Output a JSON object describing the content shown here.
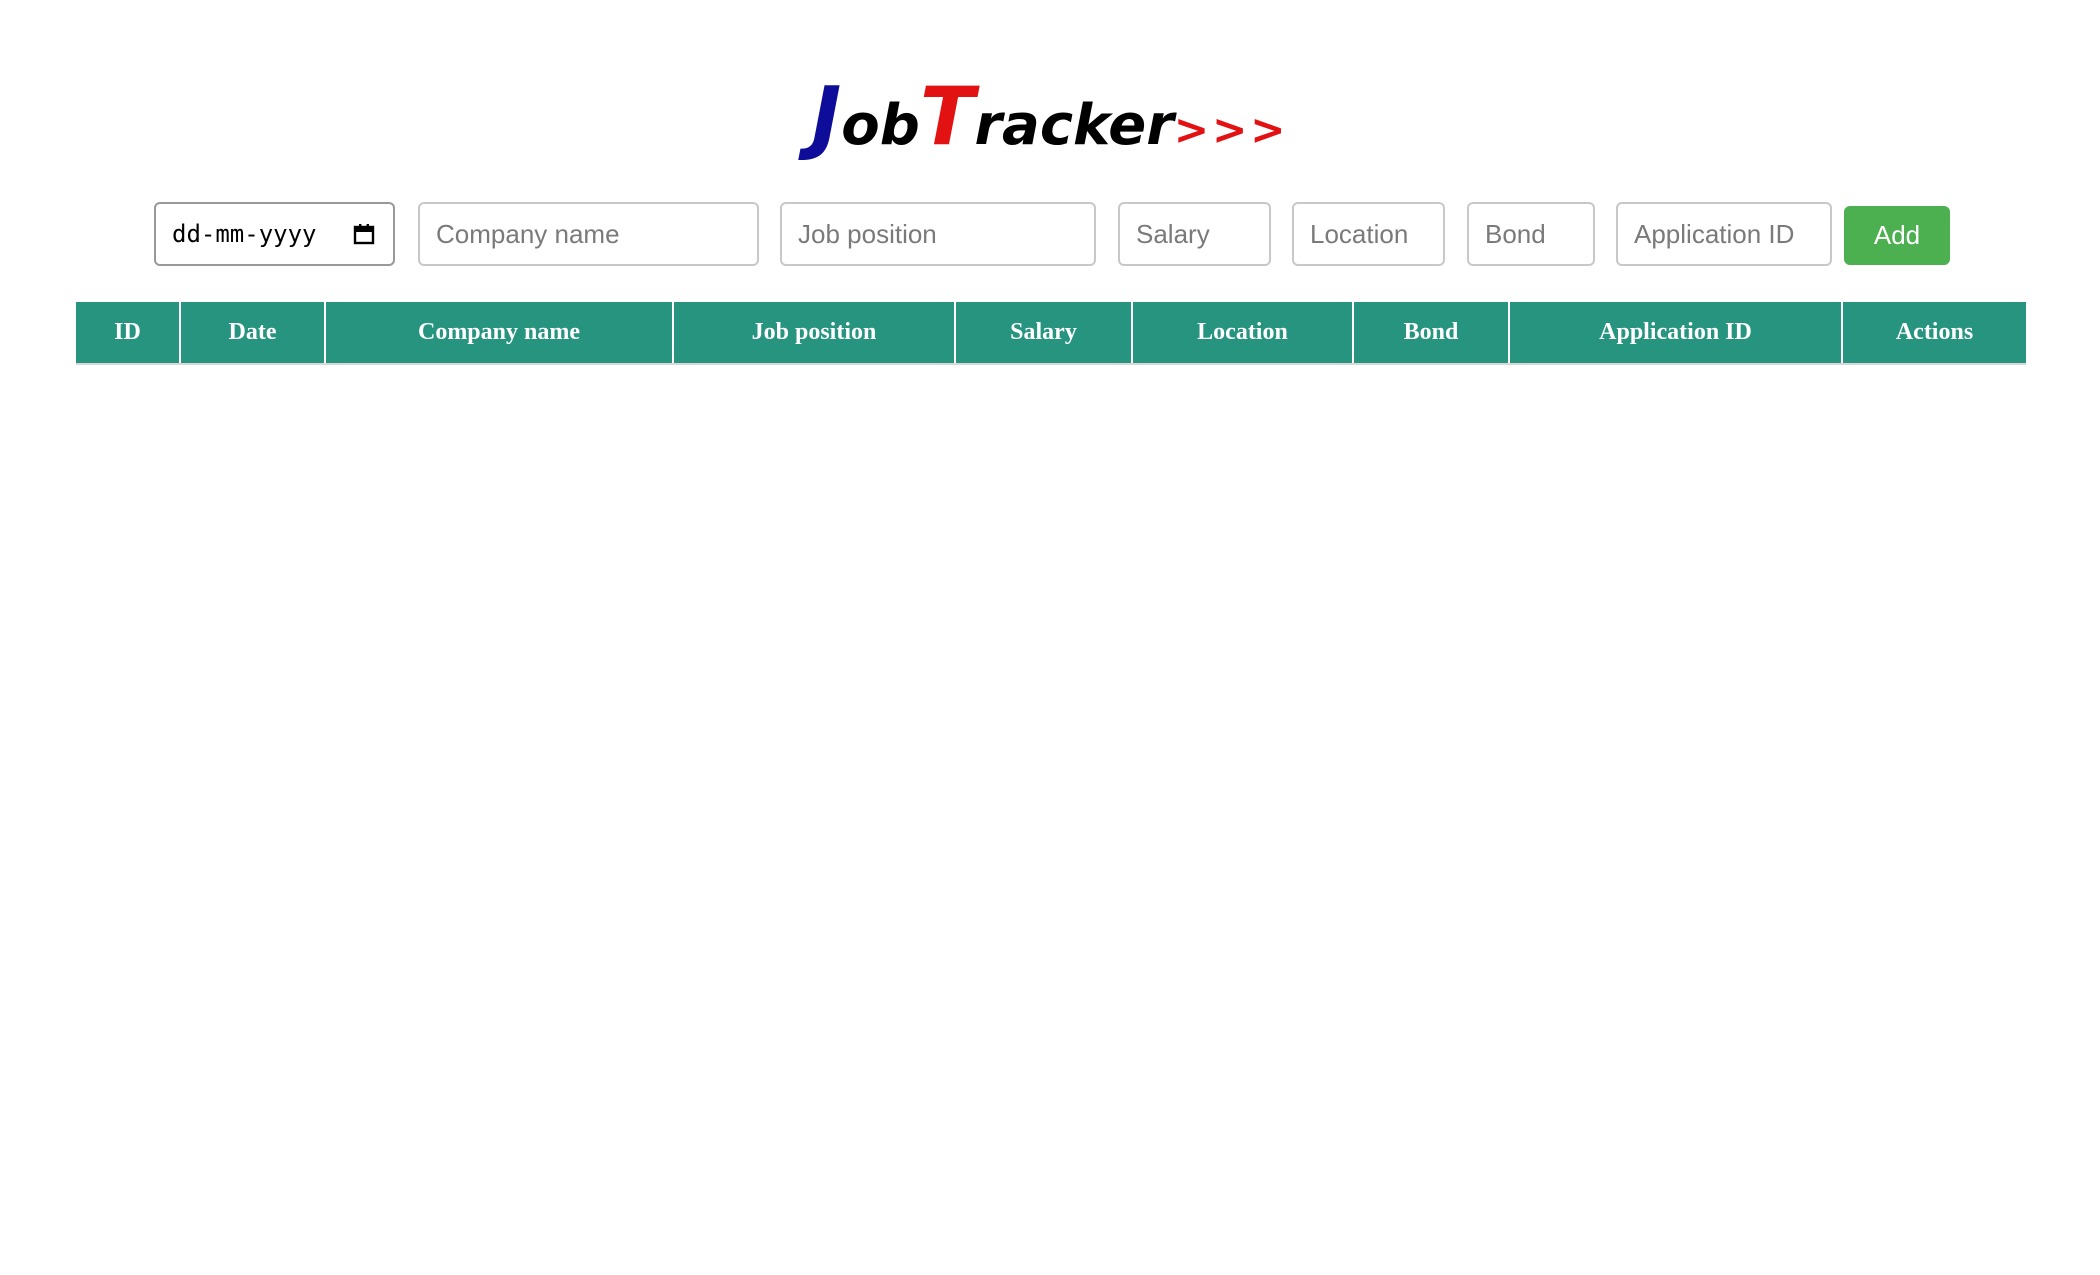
{
  "logo": {
    "first_initial": "J",
    "first_rest": "ob",
    "second_initial": "T",
    "second_rest": "racker",
    "suffix": ">>>"
  },
  "form": {
    "date": {
      "value": "dd-mm-yyyy",
      "icon": "calendar-icon"
    },
    "company_name": {
      "placeholder": "Company name"
    },
    "job_position": {
      "placeholder": "Job position"
    },
    "salary": {
      "placeholder": "Salary"
    },
    "location": {
      "placeholder": "Location"
    },
    "bond": {
      "placeholder": "Bond"
    },
    "application_id": {
      "placeholder": "Application ID"
    },
    "add_label": "Add"
  },
  "table": {
    "columns": [
      "ID",
      "Date",
      "Company name",
      "Job position",
      "Salary",
      "Location",
      "Bond",
      "Application ID",
      "Actions"
    ],
    "rows": []
  },
  "colors": {
    "header_bg": "#279480",
    "add_button": "#4caf50",
    "logo_blue": "#0d0d99",
    "logo_red": "#e31212"
  }
}
